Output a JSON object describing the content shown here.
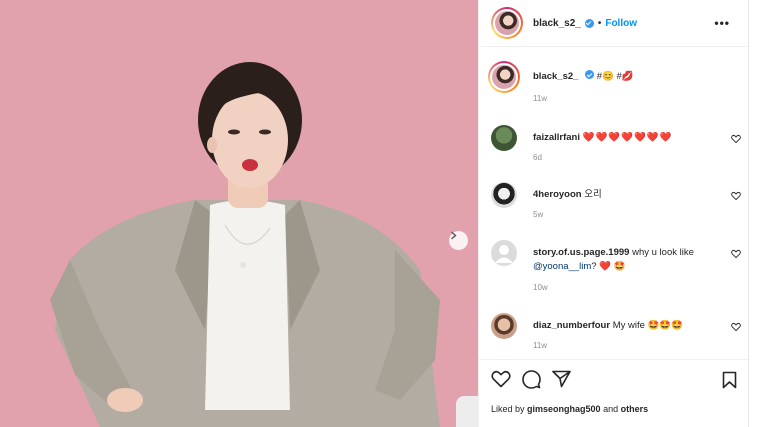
{
  "post": {
    "username": "black_s2_",
    "follow_label": "Follow",
    "separator": "•",
    "more_label": "•••"
  },
  "caption": {
    "username": "black_s2_",
    "text": "#😊 #💋",
    "time": "11w"
  },
  "comments": [
    {
      "username": "faizallrfani",
      "text": "❤️❤️❤️❤️❤️❤️❤️",
      "time": "6d"
    },
    {
      "username": "4heroyoon",
      "text": "오리",
      "time": "5w"
    },
    {
      "username": "story.of.us.page.1999",
      "text_before": "why u look like",
      "mention": "@yoona__lim",
      "text_after": "? ❤️ 🤩",
      "time": "10w"
    },
    {
      "username": "diaz_numberfour",
      "text": "My wife 🤩🤩🤩",
      "time": "11w"
    }
  ],
  "likes": {
    "prefix": "Liked by",
    "user": "gimseonghag500",
    "joiner": "and",
    "others": "others"
  },
  "colors": {
    "photo_background": "#e1a2ad",
    "link_blue": "#0095f6",
    "verified": "#3897f0",
    "muted_text": "#8e8e8e"
  },
  "icons": [
    "chevron-right-icon",
    "verified-icon",
    "more-icon",
    "heart-icon",
    "comment-icon",
    "share-icon",
    "bookmark-icon"
  ]
}
